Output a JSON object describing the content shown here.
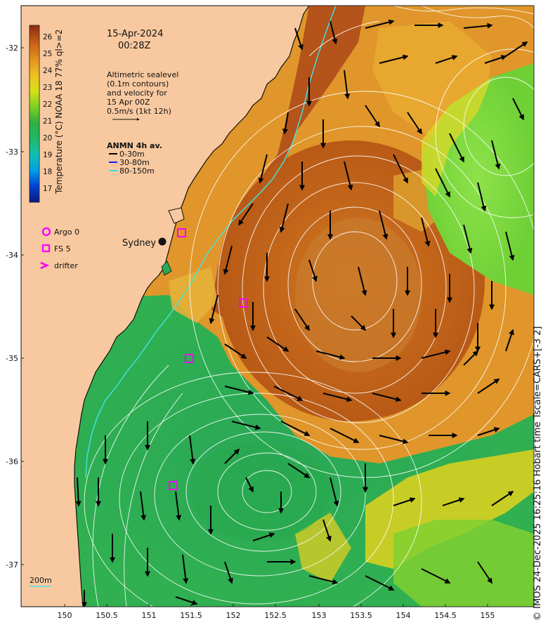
{
  "map": {
    "date": "15-Apr-2024",
    "time": "00:28Z",
    "altimetry_note": [
      "Altimetric sealevel",
      "(0.1m contours)",
      "and velocity for",
      "15 Apr 00Z",
      "0.5m/s (1kt 12h)"
    ],
    "anmn_title": "ANMN 4h av.",
    "anmn_legend": [
      {
        "label": "0-30m",
        "color": "#000000"
      },
      {
        "label": "30-80m",
        "color": "#1a1aff"
      },
      {
        "label": "80-150m",
        "color": "#33e0e0"
      }
    ],
    "obs_legend": [
      {
        "label": "Argo 0",
        "icon": "circle-marker-icon",
        "color": "#ff00ff"
      },
      {
        "label": "FS 5",
        "icon": "square-marker-icon",
        "color": "#ff00ff"
      },
      {
        "label": "drifter",
        "icon": "chevron-marker-icon",
        "color": "#ff00ff"
      }
    ],
    "city_label": "Sydney",
    "depth_label": "200m",
    "credit": "© IMOS 24-Dec-2025 16:25:16 Hobart time Tscale=CARS+[-3 2]",
    "colorbar": {
      "label": "Temperature (°C) NOAA 18 77% ql>=2",
      "ticks": [
        "26",
        "25",
        "24",
        "23",
        "22",
        "21",
        "20",
        "19",
        "18",
        "17"
      ],
      "colors": [
        "#0a1a80",
        "#0040d0",
        "#00a0e8",
        "#10c0b0",
        "#20b868",
        "#30b040",
        "#80d020",
        "#d8e018",
        "#f0c020",
        "#e09020",
        "#c86018",
        "#8a2a10"
      ]
    },
    "lat_ticks": [
      "-32",
      "-33",
      "-34",
      "-35",
      "-36",
      "-37"
    ],
    "lon_ticks": [
      "150",
      "150.5",
      "151",
      "151.5",
      "152",
      "152.5",
      "153",
      "153.5",
      "154",
      "154.5",
      "155"
    ],
    "colors": {
      "land": "#f8c9a0",
      "coastline": "#111111"
    }
  }
}
